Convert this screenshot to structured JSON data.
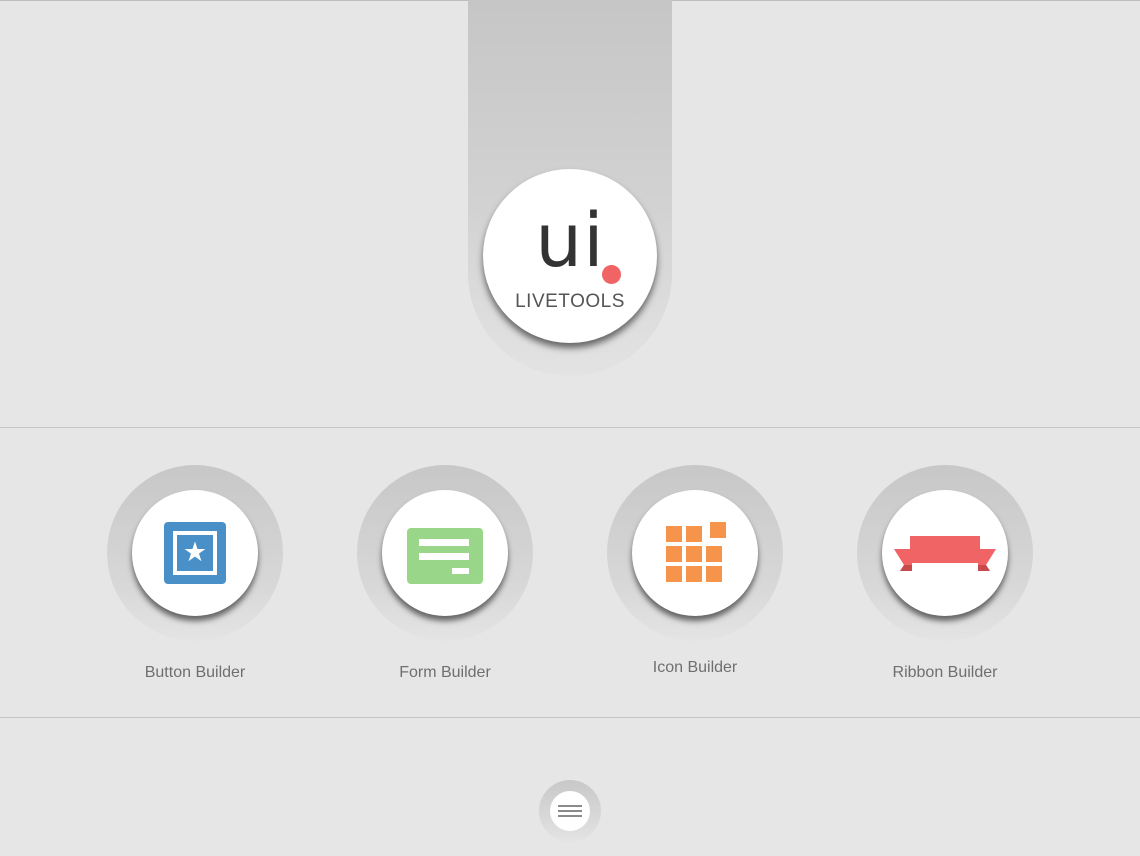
{
  "logo": {
    "mark": "ui",
    "subtitle": "LIVETOOLS",
    "dot_color": "#f06466"
  },
  "tools": [
    {
      "label": "Button Builder",
      "icon": "star-square-icon",
      "color": "#4a90c8"
    },
    {
      "label": "Form Builder",
      "icon": "form-icon",
      "color": "#9ad68a"
    },
    {
      "label": "Icon Builder",
      "icon": "grid-icon",
      "color": "#f6944b"
    },
    {
      "label": "Ribbon Builder",
      "icon": "ribbon-icon",
      "color": "#f06466"
    }
  ],
  "menu": {
    "icon": "hamburger-icon"
  }
}
